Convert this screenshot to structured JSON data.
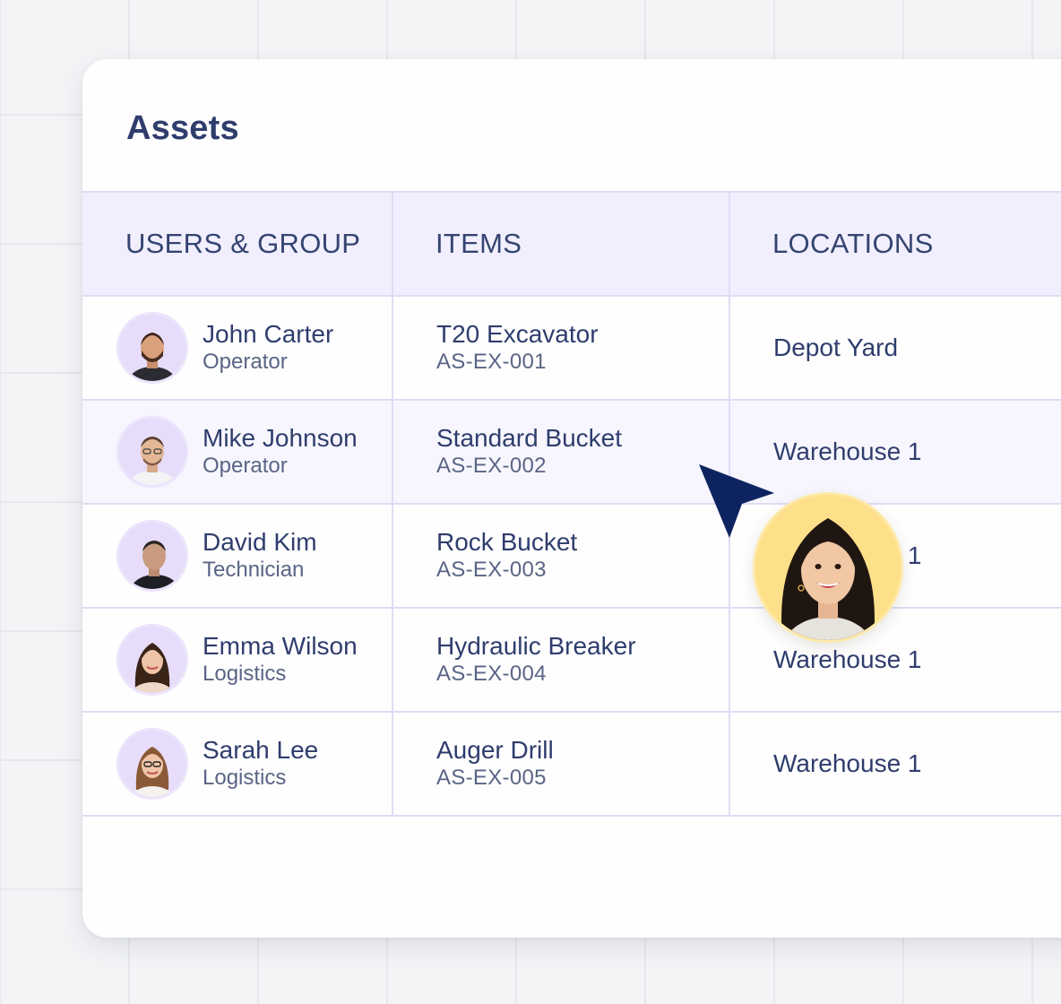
{
  "card": {
    "title": "Assets"
  },
  "table": {
    "columns": [
      "USERS & GROUP",
      "ITEMS",
      "LOCATIONS"
    ],
    "rows": [
      {
        "user": {
          "name": "John Carter",
          "role": "Operator"
        },
        "item": {
          "name": "T20 Excavator",
          "code": "AS-EX-001"
        },
        "location": "Depot Yard"
      },
      {
        "user": {
          "name": "Mike Johnson",
          "role": "Operator"
        },
        "item": {
          "name": "Standard Bucket",
          "code": "AS-EX-002"
        },
        "location": "Warehouse 1"
      },
      {
        "user": {
          "name": "David Kim",
          "role": "Technician"
        },
        "item": {
          "name": "Rock Bucket",
          "code": "AS-EX-003"
        },
        "location": "Warehouse 1"
      },
      {
        "user": {
          "name": "Emma Wilson",
          "role": "Logistics"
        },
        "item": {
          "name": "Hydraulic Breaker",
          "code": "AS-EX-004"
        },
        "location": "Warehouse 1"
      },
      {
        "user": {
          "name": "Sarah Lee",
          "role": "Logistics"
        },
        "item": {
          "name": "Auger Drill",
          "code": "AS-EX-005"
        },
        "location": "Warehouse 1"
      }
    ]
  },
  "overlay": {
    "cursor_icon": "pointer-arrow-icon",
    "collaborator_icon": "collaborator-avatar"
  },
  "colors": {
    "page_bg": "#f3f4f6",
    "card_bg": "#fefefe",
    "title": "#2f3d6d",
    "header_bg": "#f1effd",
    "border": "#e0dcf4",
    "avatar_bg": "#e7ddfa",
    "cursor": "#0e2460",
    "collaborator_bg": "#ffe08a"
  }
}
